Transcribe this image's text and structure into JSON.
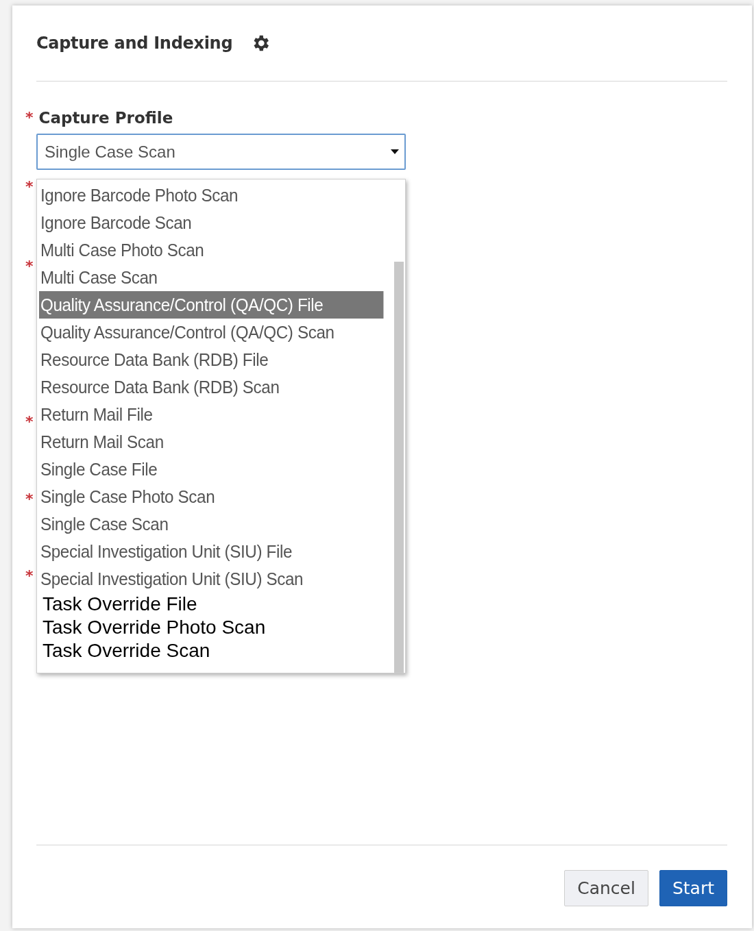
{
  "dialog": {
    "title": "Capture and Indexing"
  },
  "capture_profile": {
    "label": "Capture Profile",
    "required_mark": "*",
    "value": "Single Case Scan",
    "expanded": true
  },
  "hidden_field_marks": [
    "*",
    "*",
    "*",
    "*",
    "*"
  ],
  "options": [
    {
      "label": "Ignore Barcode Photo Scan",
      "selected": false,
      "kind": "styled"
    },
    {
      "label": "Ignore Barcode Scan",
      "selected": false,
      "kind": "styled"
    },
    {
      "label": "Multi Case Photo Scan",
      "selected": false,
      "kind": "styled"
    },
    {
      "label": "Multi Case Scan",
      "selected": false,
      "kind": "styled"
    },
    {
      "label": "Quality Assurance/Control (QA/QC) File",
      "selected": true,
      "kind": "styled"
    },
    {
      "label": "Quality Assurance/Control (QA/QC) Scan",
      "selected": false,
      "kind": "styled"
    },
    {
      "label": "Resource Data Bank (RDB) File",
      "selected": false,
      "kind": "styled"
    },
    {
      "label": "Resource Data Bank (RDB) Scan",
      "selected": false,
      "kind": "styled"
    },
    {
      "label": "Return Mail File",
      "selected": false,
      "kind": "styled"
    },
    {
      "label": "Return Mail Scan",
      "selected": false,
      "kind": "styled"
    },
    {
      "label": "Single Case File",
      "selected": false,
      "kind": "styled"
    },
    {
      "label": "Single Case Photo Scan",
      "selected": false,
      "kind": "styled"
    },
    {
      "label": "Single Case Scan",
      "selected": false,
      "kind": "styled"
    },
    {
      "label": "Special Investigation Unit (SIU) File",
      "selected": false,
      "kind": "styled"
    },
    {
      "label": "Special Investigation Unit (SIU) Scan",
      "selected": false,
      "kind": "styled"
    },
    {
      "label": "Task Override File",
      "selected": false,
      "kind": "plain"
    },
    {
      "label": "Task Override Photo Scan",
      "selected": false,
      "kind": "plain"
    },
    {
      "label": "Task Override Scan",
      "selected": false,
      "kind": "plain"
    }
  ],
  "buttons": [
    {
      "label": "Cancel",
      "kind": "secondary"
    },
    {
      "label": "Start",
      "kind": "primary"
    }
  ]
}
